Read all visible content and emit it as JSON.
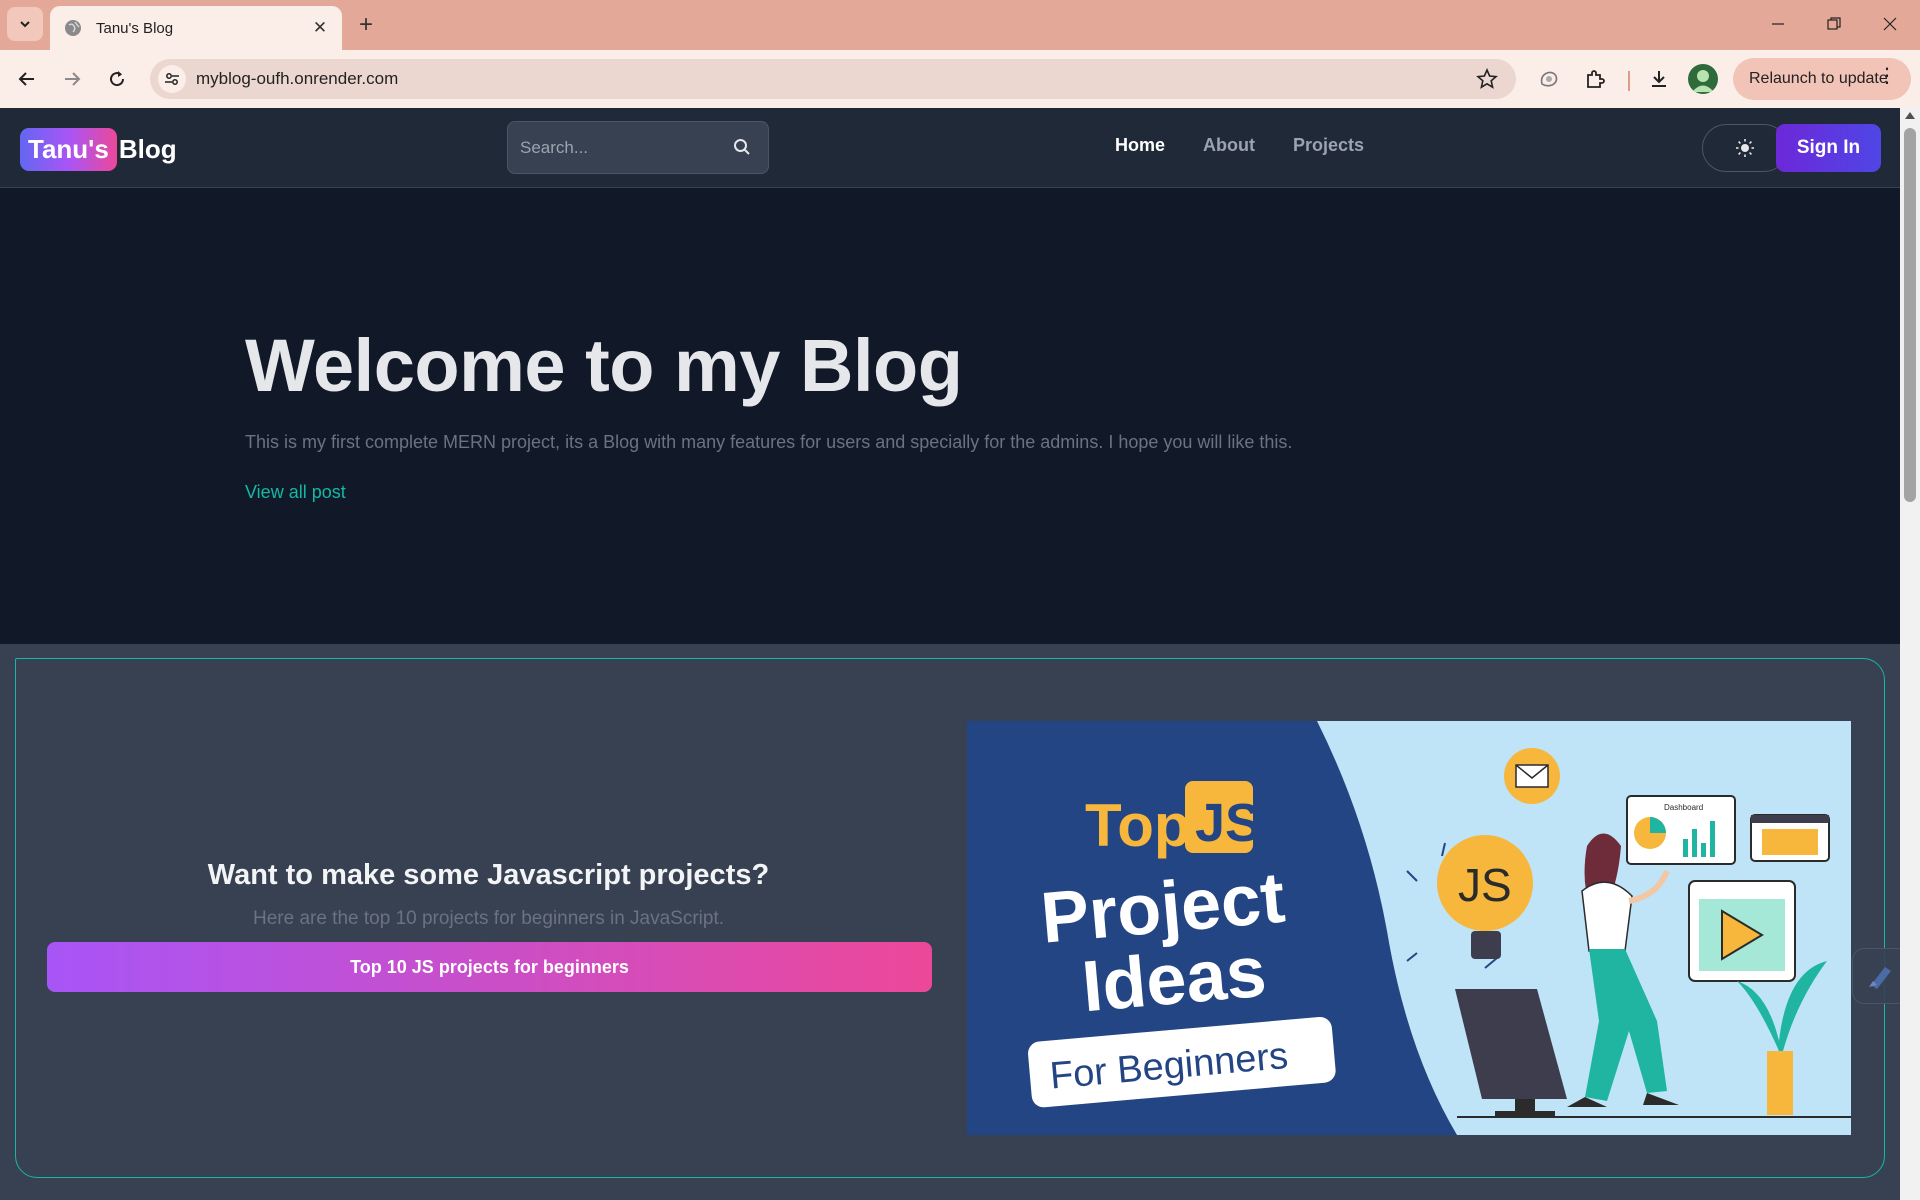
{
  "browser": {
    "tab_title": "Tanu's Blog",
    "url": "myblog-oufh.onrender.com",
    "relaunch_label": "Relaunch to update"
  },
  "header": {
    "logo_highlight": "Tanu's",
    "logo_rest": "Blog",
    "search_placeholder": "Search...",
    "nav": {
      "home": "Home",
      "about": "About",
      "projects": "Projects"
    },
    "signin_label": "Sign In"
  },
  "hero": {
    "title": "Welcome to my Blog",
    "subtitle": "This is my first complete MERN project, its a Blog with many features for users and specially for the admins. I hope you will like this.",
    "link": "View all post"
  },
  "promo": {
    "title": "Want to make some Javascript projects?",
    "subtitle": "Here are the top 10 projects for beginners in JavaScript.",
    "button": "Top 10 JS projects for beginners",
    "image": {
      "top": "Top",
      "js": "JS",
      "line1": "Project",
      "line2": "Ideas",
      "badge": "For Beginners",
      "bulb_text": "JS",
      "dashboard": "Dashboard"
    }
  },
  "colors": {
    "accent": "#14b8a6",
    "signin_bg": "#6d28d9",
    "promo_button_start": "#a855f7",
    "promo_button_end": "#ec4899",
    "tabbar": "#e4a898"
  },
  "icons": [
    "tab-list-icon",
    "globe-icon",
    "close-icon",
    "plus-icon",
    "minimize-icon",
    "restore-icon",
    "back-icon",
    "forward-icon",
    "reload-icon",
    "site-info-icon",
    "star-icon",
    "extension-icon",
    "puzzle-icon",
    "download-icon",
    "search-icon",
    "sun-icon",
    "pencil-icon"
  ]
}
